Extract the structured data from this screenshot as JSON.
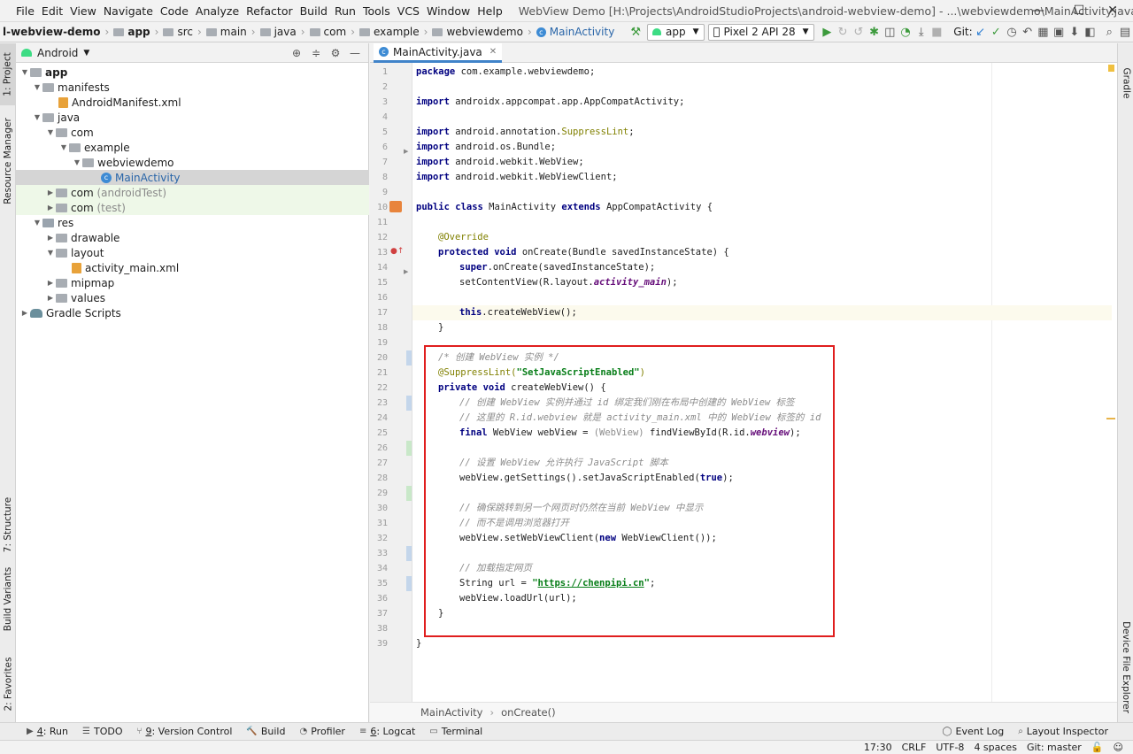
{
  "menu": {
    "items": [
      "File",
      "Edit",
      "View",
      "Navigate",
      "Code",
      "Analyze",
      "Refactor",
      "Build",
      "Run",
      "Tools",
      "VCS",
      "Window",
      "Help"
    ],
    "window_title": "WebView Demo [H:\\Projects\\AndroidStudioProjects\\android-webview-demo] - ...\\webviewdemo\\MainActivity.java [app]",
    "minimize": "—",
    "maximize": "☐",
    "close": "✕"
  },
  "breadcrumbs": [
    "l-webview-demo",
    "app",
    "src",
    "main",
    "java",
    "com",
    "example",
    "webviewdemo",
    "MainActivity"
  ],
  "toolbar": {
    "run_config": "app",
    "device": "Pixel 2 API 28",
    "git_label": "Git:"
  },
  "side_tabs": {
    "project": "1: Project",
    "resource_manager": "Resource Manager",
    "structure": "7: Structure",
    "build_variants": "Build Variants",
    "favorites": "2: Favorites",
    "gradle": "Gradle",
    "device_file_explorer": "Device File Explorer"
  },
  "project_panel": {
    "view_mode": "Android",
    "tree": [
      {
        "label": "app",
        "bold": true
      },
      {
        "label": "manifests"
      },
      {
        "label": "AndroidManifest.xml"
      },
      {
        "label": "java"
      },
      {
        "label": "com"
      },
      {
        "label": "example"
      },
      {
        "label": "webviewdemo"
      },
      {
        "label": "MainActivity"
      },
      {
        "label": "com",
        "suffix": "(androidTest)"
      },
      {
        "label": "com",
        "suffix": "(test)"
      },
      {
        "label": "res"
      },
      {
        "label": "drawable"
      },
      {
        "label": "layout"
      },
      {
        "label": "activity_main.xml"
      },
      {
        "label": "mipmap"
      },
      {
        "label": "values"
      },
      {
        "label": "Gradle Scripts"
      }
    ]
  },
  "editor": {
    "tab_label": "MainActivity.java",
    "line_numbers": [
      "1",
      "2",
      "3",
      "4",
      "5",
      "6",
      "7",
      "8",
      "9",
      "10",
      "11",
      "12",
      "13",
      "14",
      "15",
      "16",
      "17",
      "18",
      "19",
      "20",
      "21",
      "22",
      "23",
      "24",
      "25",
      "26",
      "27",
      "28",
      "29",
      "30",
      "31",
      "32",
      "33",
      "34",
      "35",
      "36",
      "37",
      "38",
      "39"
    ],
    "code": {
      "l1_kw": "package",
      "l1_rest": " com.example.webviewdemo;",
      "import_kw": "import",
      "l3_rest": " androidx.appcompat.app.AppCompatActivity;",
      "l5_rest": " android.annotation.",
      "l5_ann": "SuppressLint",
      "l5_end": ";",
      "l6_rest": " android.os.Bundle;",
      "l7_rest": " android.webkit.WebView;",
      "l8_rest": " android.webkit.WebViewClient;",
      "l10_kw1": "public class",
      "l10_mid": " MainActivity ",
      "l10_kw2": "extends",
      "l10_end": " AppCompatActivity {",
      "l12_ann": "@Override",
      "l13_kw": "protected void",
      "l13_rest": " onCreate(Bundle savedInstanceState) {",
      "l14_kw": "super",
      "l14_rest": ".onCreate(savedInstanceState);",
      "l15_pre": "setContentView(R.layout.",
      "l15_fld": "activity_main",
      "l15_end": ");",
      "l17_kw": "this",
      "l17_rest": ".createWebView();",
      "close_brace": "}",
      "l20_com": "/* 创建 WebView 实例 */",
      "l21_ann": "@SuppressLint(",
      "l21_str": "\"SetJavaScriptEnabled\"",
      "l21_end": ")",
      "l22_kw": "private void",
      "l22_rest": " createWebView() {",
      "l23_com": "// 创建 WebView 实例并通过 id 绑定我们刚在布局中创建的 WebView 标签",
      "l24_com": "// 这里的 R.id.webview 就是 activity_main.xml 中的 WebView 标签的 id",
      "l25_kw": "final",
      "l25_mid": " WebView webView = ",
      "l25_cast": "(WebView)",
      "l25_mid2": " findViewById(R.id.",
      "l25_fld": "webview",
      "l25_end": ");",
      "l27_com": "// 设置 WebView 允许执行 JavaScript 脚本",
      "l28_pre": "webView.getSettings().setJavaScriptEnabled(",
      "l28_kw": "true",
      "l28_end": ");",
      "l30_com": "// 确保跳转到另一个网页时仍然在当前 WebView 中显示",
      "l31_com": "// 而不是调用浏览器打开",
      "l32_pre": "webView.setWebViewClient(",
      "l32_kw": "new",
      "l32_end": " WebViewClient());",
      "l34_com": "// 加载指定网页",
      "l35_pre": "String url = ",
      "l35_q1": "\"",
      "l35_link": "https://chenpipi.cn",
      "l35_q2": "\"",
      "l35_end": ";",
      "l36": "webView.loadUrl(url);"
    },
    "breadcrumb": [
      "MainActivity",
      "onCreate()"
    ]
  },
  "bottom_tools": [
    {
      "key": "4",
      "label": ": Run",
      "icon": "▶"
    },
    {
      "key": "",
      "label": "TODO",
      "icon": "☰"
    },
    {
      "key": "9",
      "label": ": Version Control",
      "icon": "⑂"
    },
    {
      "key": "",
      "label": "Build",
      "icon": "🔨"
    },
    {
      "key": "",
      "label": "Profiler",
      "icon": "◔"
    },
    {
      "key": "6",
      "label": ": Logcat",
      "icon": "≡"
    },
    {
      "key": "",
      "label": "Terminal",
      "icon": "▭"
    }
  ],
  "bottom_right_tools": [
    "Event Log",
    "Layout Inspector"
  ],
  "status": {
    "position": "17:30",
    "line_sep": "CRLF",
    "encoding": "UTF-8",
    "indent": "4 spaces",
    "branch": "Git: master"
  }
}
